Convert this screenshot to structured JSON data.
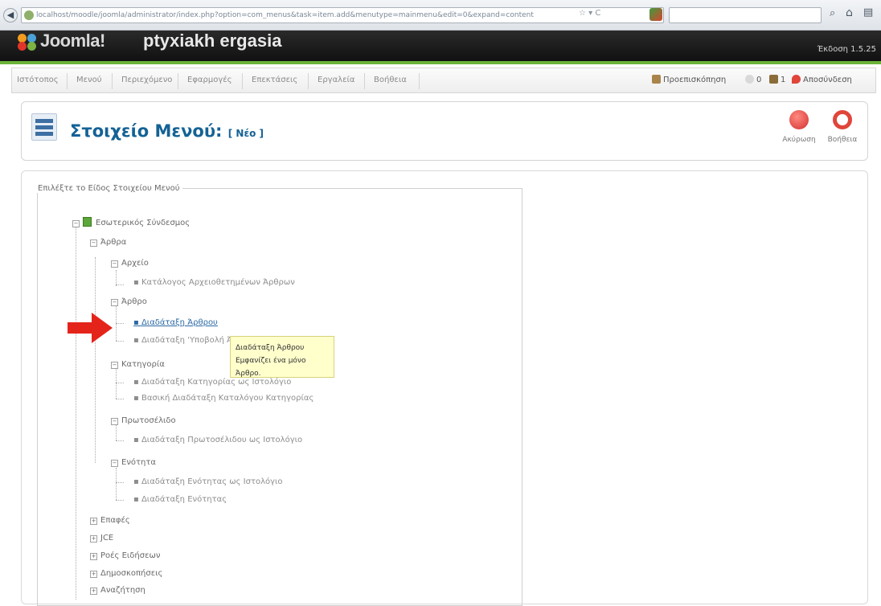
{
  "browser": {
    "url": "localhost/moodle/joomla/administrator/index.php?option=com_menus&task=item.add&menutype=mainmenu&edit=0&expand=content",
    "url_tools": "☆ ▾ C"
  },
  "header": {
    "brand": "Joomla!",
    "site_name": "ptyxiakh ergasia",
    "version": "Έκδοση 1.5.25"
  },
  "menubar": {
    "items": [
      "Ιστότοπος",
      "Μενού",
      "Περιεχόμενο",
      "Εφαρμογές",
      "Επεκτάσεις",
      "Εργαλεία",
      "Βοήθεια"
    ],
    "preview": "Προεπισκόπηση",
    "messages": "0",
    "users": "1",
    "logout": "Αποσύνδεση"
  },
  "toolbar": {
    "title": "Στοιχείο Μενού:",
    "title_sub": "[ Νέο ]",
    "cancel_label": "Ακύρωση",
    "help_label": "Βοήθεια"
  },
  "tree": {
    "legend": "Επιλέξτε το Είδος Στοιχείου Μενού",
    "root": "Εσωτερικός Σύνδεσμος",
    "articles": "Άρθρα",
    "archive": "Αρχείο",
    "archive_list": "Κατάλογος Αρχειοθετημένων Άρθρων",
    "article": "Άρθρο",
    "article_layout": "Διαδάταξη Άρθρου",
    "article_submit": "Διαδάταξη 'Υποβολή Άρθρου'",
    "category": "Κατηγορία",
    "category_list": "Διαδάταξη Κατηγορίας ως Ιστολόγιο",
    "category_table": "Βασική Διαδάταξη Καταλόγου Κατηγορίας",
    "frontpage": "Πρωτοσέλιδο",
    "frontpage_blog": "Διαδάταξη Πρωτοσέλιδου ως Ιστολόγιο",
    "section": "Ενότητα",
    "section_blog": "Διαδάταξη Ενότητας ως Ιστολόγιο",
    "section_layout": "Διαδάταξη Ενότητας",
    "contacts": "Επαφές",
    "jce": "JCE",
    "newsfeeds": "Ροές Ειδήσεων",
    "polls": "Δημοσκοπήσεις",
    "search": "Αναζήτηση"
  },
  "tooltip": {
    "title": "Διαδάταξη Άρθρου",
    "text": "Εμφανίζει ένα μόνο Άρθρο."
  },
  "colors": {
    "joomla_green": "#6bb33a",
    "title_blue": "#146295",
    "arrow_red": "#e4241b",
    "tooltip_bg": "#ffffcc"
  }
}
